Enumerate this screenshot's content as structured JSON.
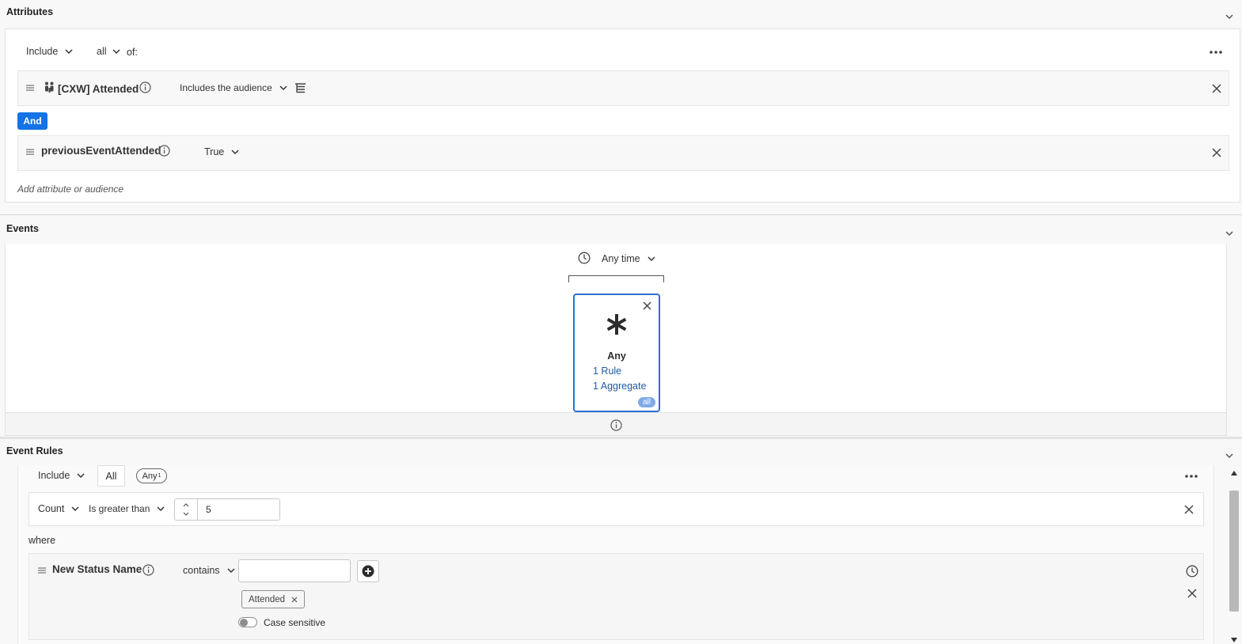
{
  "attributes": {
    "title": "Attributes",
    "include_label": "Include",
    "all_label": "all",
    "of_label": "of:",
    "rule1": {
      "name": "[CXW] Attended",
      "operator": "Includes the audience"
    },
    "and_label": "And",
    "rule2": {
      "name": "previousEventAttended",
      "value": "True"
    },
    "add_placeholder": "Add attribute or audience"
  },
  "events": {
    "title": "Events",
    "time_label": "Any time",
    "card": {
      "name": "Any",
      "rules": "1 Rule",
      "aggregates": "1 Aggregate",
      "badge": "all"
    }
  },
  "event_rules": {
    "title": "Event Rules",
    "include_label": "Include",
    "all_tab": "All",
    "any_tab": "Any",
    "any_count": "1",
    "count_label": "Count",
    "comparator": "Is greater than",
    "count_value": "5",
    "where_label": "where",
    "field_name": "New Status Name",
    "field_operator": "contains",
    "field_input_value": "",
    "tag": "Attended",
    "case_sensitive": "Case sensitive"
  },
  "colors": {
    "accent": "#1473e6",
    "link": "#1e5ba8",
    "card_border": "#2d6fcf"
  }
}
